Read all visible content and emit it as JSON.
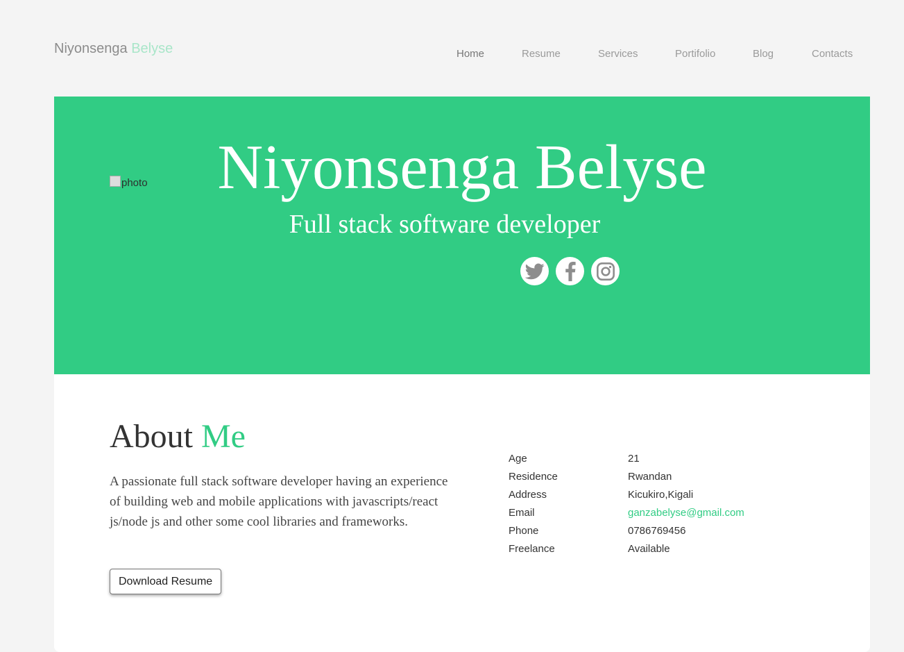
{
  "brand": {
    "first": "Niyonsenga",
    "last": "Belyse",
    "accent_color": "#a9e6c9"
  },
  "nav": [
    {
      "label": "Home",
      "active": true
    },
    {
      "label": "Resume"
    },
    {
      "label": "Services"
    },
    {
      "label": "Portifolio"
    },
    {
      "label": "Blog"
    },
    {
      "label": "Contacts"
    }
  ],
  "hero": {
    "photo_alt": "photo",
    "name": "Niyonsenga Belyse",
    "title": "Full stack software developer",
    "background": "#31cc84",
    "socials": [
      "twitter-icon",
      "facebook-icon",
      "instagram-icon"
    ]
  },
  "about": {
    "heading_first": "About",
    "heading_accent": "Me",
    "text": "A passionate full stack software developer having an experience of building web and mobile applications with javascripts/react js/node js and other some cool libraries and frameworks.",
    "button": "Download Resume",
    "info": [
      {
        "label": "Age",
        "value": "21"
      },
      {
        "label": "Residence",
        "value": "Rwandan"
      },
      {
        "label": "Address",
        "value": "Kicukiro,Kigali"
      },
      {
        "label": "Email",
        "value": "ganzabelyse@gmail.com"
      },
      {
        "label": "Phone",
        "value": "0786769456"
      },
      {
        "label": "Freelance",
        "value": "Available"
      }
    ]
  }
}
